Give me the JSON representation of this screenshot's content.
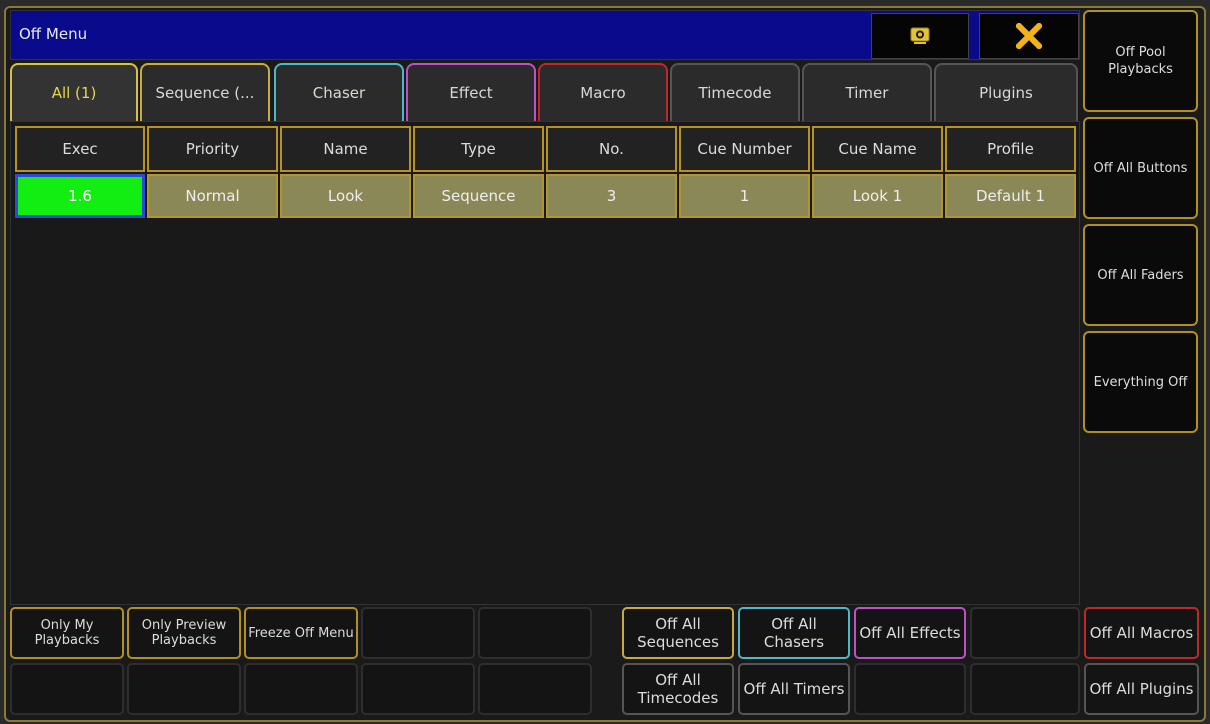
{
  "window": {
    "title": "Off Menu",
    "screenshot_icon": "screenshot-icon",
    "close_icon": "close-x-icon"
  },
  "tabs": [
    {
      "label": "All (1)",
      "color": "#d6c14a",
      "active": true
    },
    {
      "label": "Sequence (...",
      "color": "#c8aa40"
    },
    {
      "label": "Chaser",
      "color": "#4fb8c8"
    },
    {
      "label": "Effect",
      "color": "#c050c8"
    },
    {
      "label": "Macro",
      "color": "#c02828"
    },
    {
      "label": "Timecode",
      "color": "#555555"
    },
    {
      "label": "Timer",
      "color": "#555555"
    },
    {
      "label": "Plugins",
      "color": "#555555"
    }
  ],
  "table": {
    "headers": [
      "Exec",
      "Priority",
      "Name",
      "Type",
      "No.",
      "Cue Number",
      "Cue Name",
      "Profile"
    ],
    "rows": [
      [
        "1.6",
        "Normal",
        "Look",
        "Sequence",
        "3",
        "1",
        "Look 1",
        "Default 1"
      ]
    ]
  },
  "right_buttons": [
    {
      "label": "Off Pool Playbacks"
    },
    {
      "label": "Off All Buttons"
    },
    {
      "label": "Off All Faders"
    },
    {
      "label": "Everything Off"
    }
  ],
  "bottom_row1": [
    {
      "label": "Only My Playbacks",
      "color": "#b09020"
    },
    {
      "label": "Only Preview Playbacks",
      "color": "#b09020"
    },
    {
      "label": "Freeze Off Menu",
      "color": "#b09020"
    },
    {
      "label": "",
      "color": "#2e2e2e"
    },
    {
      "label": "",
      "color": "#2e2e2e"
    },
    {
      "label": "Off All Sequences",
      "color": "#c8aa40"
    },
    {
      "label": "Off All Chasers",
      "color": "#4fb8c8"
    },
    {
      "label": "Off All Effects",
      "color": "#c050c8"
    },
    {
      "label": "",
      "color": "#2e2e2e"
    },
    {
      "label": "Off All Macros",
      "color": "#c02828"
    }
  ],
  "bottom_row2": [
    {
      "label": "",
      "color": "#2e2e2e"
    },
    {
      "label": "",
      "color": "#2e2e2e"
    },
    {
      "label": "",
      "color": "#2e2e2e"
    },
    {
      "label": "",
      "color": "#2e2e2e"
    },
    {
      "label": "",
      "color": "#2e2e2e"
    },
    {
      "label": "Off All Timecodes",
      "color": "#555555"
    },
    {
      "label": "Off All Timers",
      "color": "#555555"
    },
    {
      "label": "",
      "color": "#2e2e2e"
    },
    {
      "label": "",
      "color": "#2e2e2e"
    },
    {
      "label": "Off All Plugins",
      "color": "#555555"
    }
  ]
}
